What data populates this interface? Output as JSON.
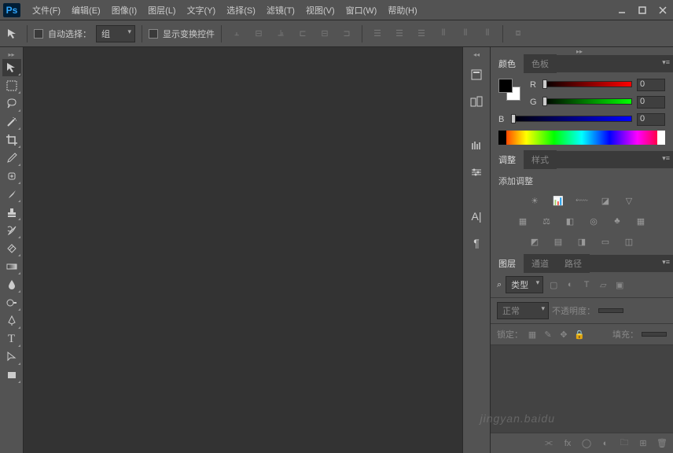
{
  "menu": {
    "items": [
      "文件(F)",
      "编辑(E)",
      "图像(I)",
      "图层(L)",
      "文字(Y)",
      "选择(S)",
      "滤镜(T)",
      "视图(V)",
      "窗口(W)",
      "帮助(H)"
    ]
  },
  "optbar": {
    "auto_select": "自动选择：",
    "group": "组",
    "show_transform": "显示变换控件"
  },
  "panels": {
    "color": {
      "tab_color": "颜色",
      "tab_swatches": "色板",
      "r": "R",
      "g": "G",
      "b": "B",
      "r_val": "0",
      "g_val": "0",
      "b_val": "0"
    },
    "adjust": {
      "tab_adjust": "调整",
      "tab_styles": "样式",
      "title": "添加调整"
    },
    "layers": {
      "tab_layers": "图层",
      "tab_channels": "通道",
      "tab_paths": "路径",
      "kind": "类型",
      "blend": "正常",
      "opacity_label": "不透明度：",
      "lock_label": "锁定：",
      "fill_label": "填充：",
      "search_icon": "⌕"
    }
  },
  "watermark": "jingyan.baidu"
}
